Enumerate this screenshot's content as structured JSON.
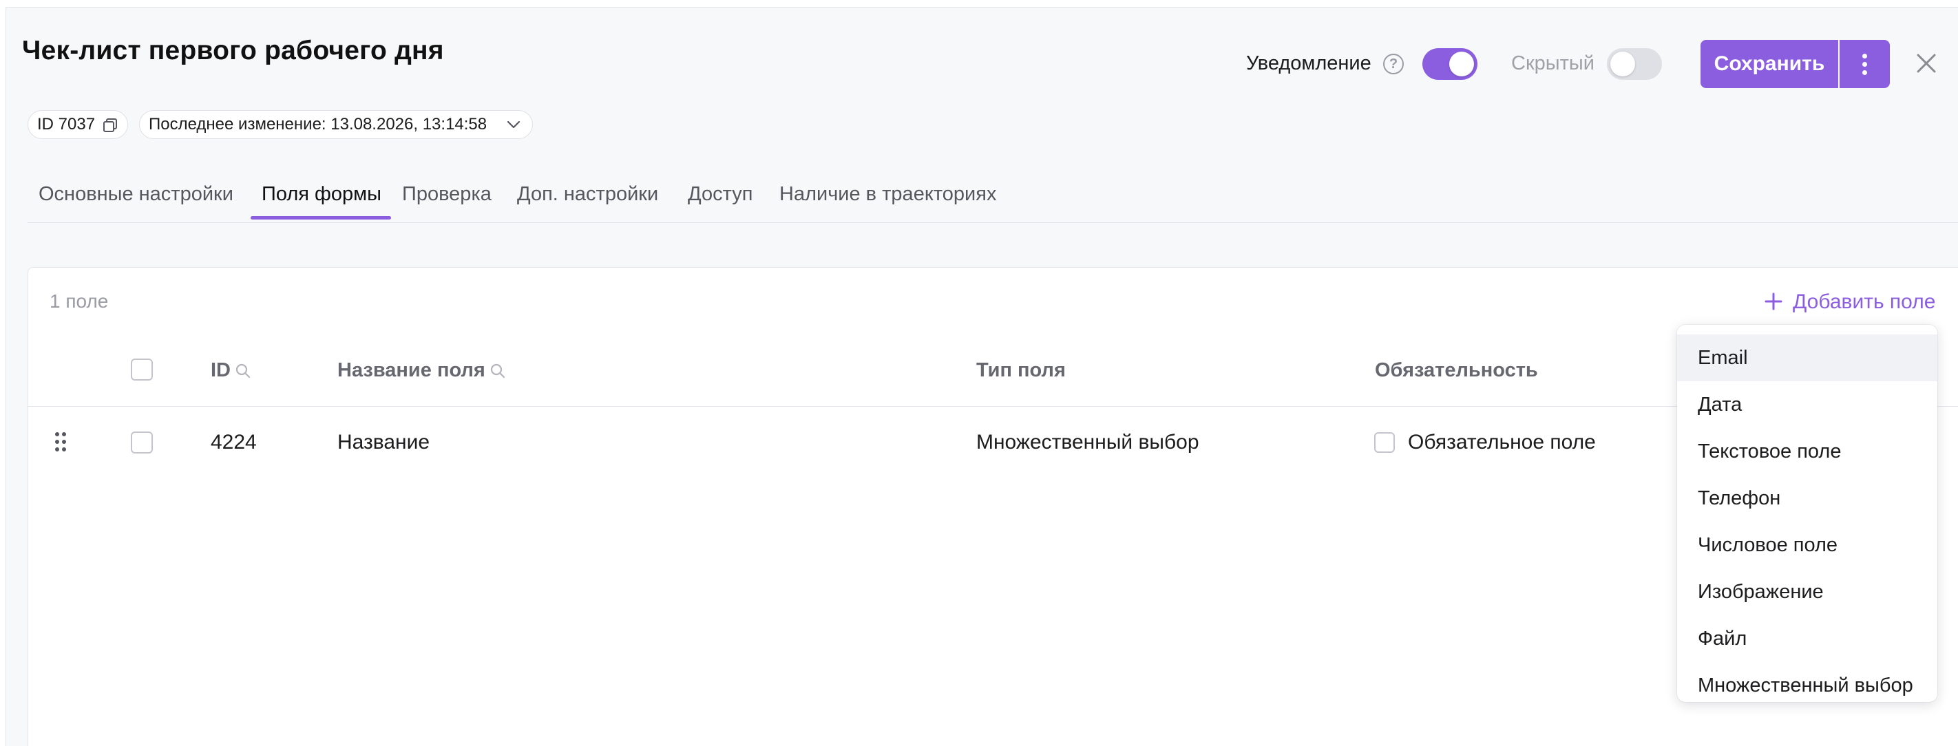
{
  "header": {
    "title": "Чек-лист первого рабочего дня",
    "notification_label": "Уведомление",
    "notification_on": true,
    "hidden_label": "Скрытый",
    "hidden_on": false,
    "save_label": "Сохранить",
    "help_symbol": "?"
  },
  "meta": {
    "id_chip": "ID 7037",
    "last_modified": "Последнее изменение: 13.08.2026, 13:14:58"
  },
  "tabs": [
    {
      "label": "Основные настройки",
      "active": false
    },
    {
      "label": "Поля формы",
      "active": true
    },
    {
      "label": "Проверка",
      "active": false
    },
    {
      "label": "Доп. настройки",
      "active": false
    },
    {
      "label": "Доступ",
      "active": false
    },
    {
      "label": "Наличие в траекториях",
      "active": false
    }
  ],
  "table": {
    "count_label": "1 поле",
    "add_field_label": "Добавить поле",
    "columns": {
      "id": "ID",
      "name": "Название поля",
      "type": "Тип поля",
      "required": "Обязательность"
    },
    "rows": [
      {
        "id": "4224",
        "name": "Название",
        "type": "Множественный выбор",
        "required_label": "Обязательное поле",
        "required": false
      }
    ]
  },
  "dropdown": {
    "items": [
      "Email",
      "Дата",
      "Текстовое поле",
      "Телефон",
      "Числовое поле",
      "Изображение",
      "Файл",
      "Множественный выбор"
    ],
    "highlighted_index": 0
  },
  "colors": {
    "accent": "#8b5ee0",
    "background": "#f7f8fa"
  }
}
